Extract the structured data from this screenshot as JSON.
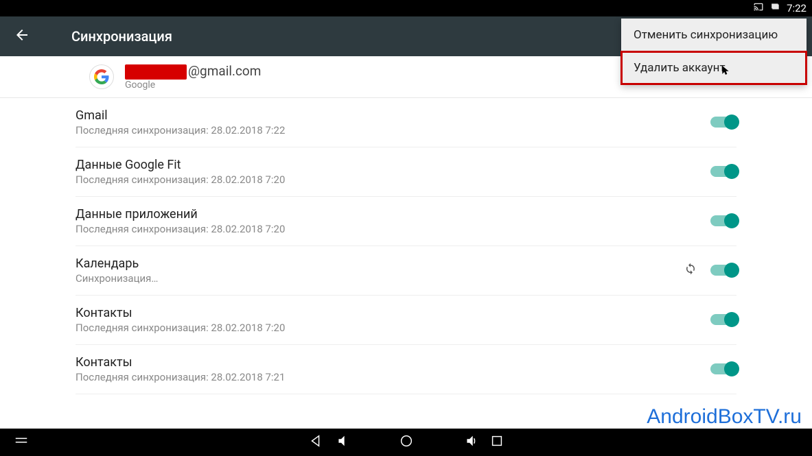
{
  "status_bar": {
    "time": "7:22"
  },
  "action_bar": {
    "title": "Синхронизация"
  },
  "overflow_menu": {
    "cancel_sync": "Отменить синхронизацию",
    "delete_account": "Удалить аккаунт"
  },
  "account": {
    "email_suffix": "@gmail.com",
    "provider": "Google"
  },
  "sync_items": [
    {
      "name": "Gmail",
      "sub": "Последняя синхронизация: 28.02.2018 7:22",
      "syncing": false
    },
    {
      "name": "Данные Google Fit",
      "sub": "Последняя синхронизация: 28.02.2018 7:20",
      "syncing": false
    },
    {
      "name": "Данные приложений",
      "sub": "Последняя синхронизация: 28.02.2018 7:20",
      "syncing": false
    },
    {
      "name": "Календарь",
      "sub": "Синхронизация…",
      "syncing": true
    },
    {
      "name": "Контакты",
      "sub": "Последняя синхронизация: 28.02.2018 7:20",
      "syncing": false
    },
    {
      "name": "Контакты",
      "sub": "Последняя синхронизация: 28.02.2018 7:21",
      "syncing": false
    }
  ],
  "watermark": "AndroidBoxTV.ru"
}
